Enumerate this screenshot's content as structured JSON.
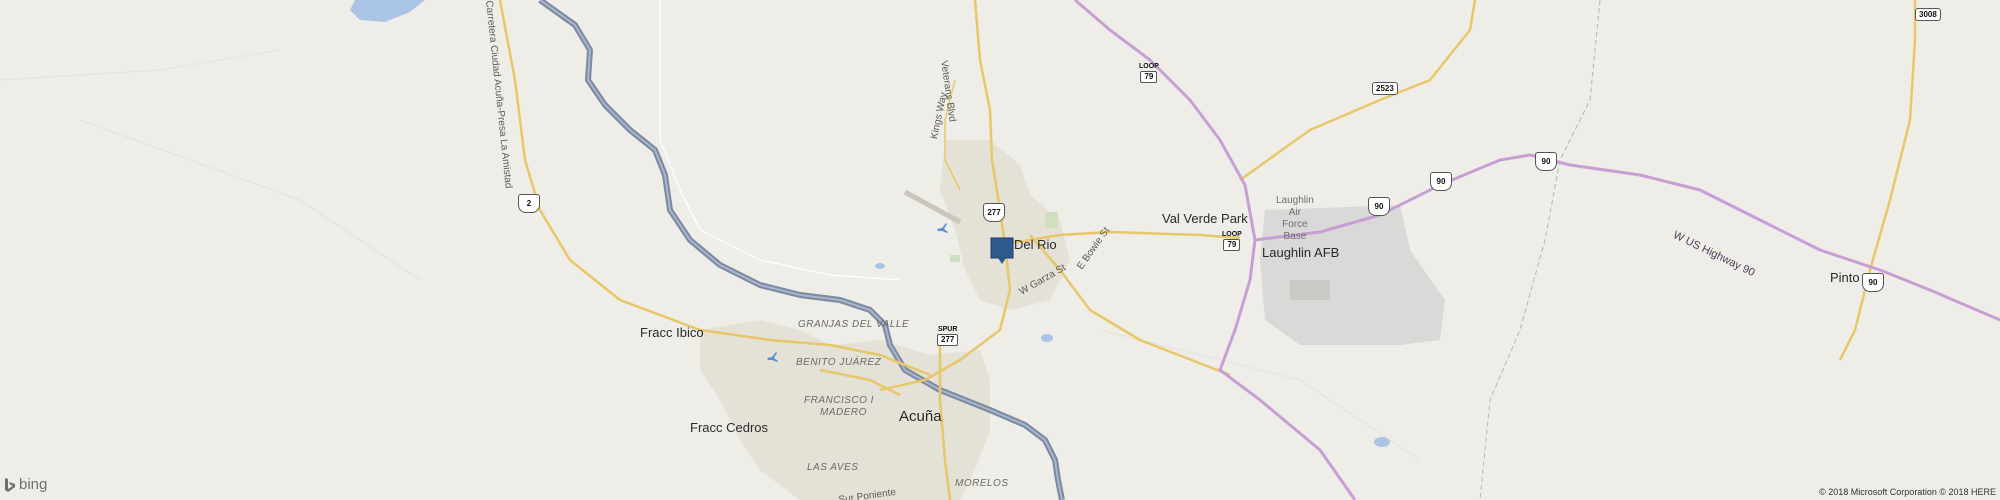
{
  "map": {
    "places": {
      "del_rio": "Del Rio",
      "val_verde_park": "Val Verde Park",
      "laughlin_afb": "Laughlin AFB",
      "pinto": "Pinto",
      "fracc_ibico": "Fracc Ibico",
      "fracc_cedros": "Fracc Cedros",
      "acuna": "Acuña"
    },
    "districts": {
      "granjas_del_valle": "GRANJAS DEL VALLE",
      "benito_juarez": "BENITO JUÁREZ",
      "francisco_madero_1": "FRANCISCO I",
      "francisco_madero_2": "MADERO",
      "las_aves": "LAS AVES",
      "morelos": "MORELOS"
    },
    "base_label": [
      "Laughlin",
      "Air",
      "Force",
      "Base"
    ],
    "streets": {
      "veterans_blvd": "Veterans Blvd",
      "kings_way": "Kings Way",
      "w_garza_st": "W Garza St",
      "e_bowie_st": "E Bowie St",
      "carretera": "Carretera Ciudad Acuña-Presa La Amistad",
      "sur_poniente": "Sur Poniente",
      "w_us_highway_90": "W US Highway 90"
    },
    "shields": {
      "us277_a": "277",
      "spur_label": "SPUR",
      "spur_num": "277",
      "loop_north_label": "LOOP",
      "loop_north_num": "79",
      "loop_south_label": "LOOP",
      "loop_south_num": "79",
      "fm2523": "2523",
      "fm3008": "3008",
      "us90_a": "90",
      "us90_b": "90",
      "us90_c": "90",
      "us90_d": "90",
      "mx2": "2"
    },
    "marker": "location-pin",
    "colors": {
      "land": "#efede8",
      "river": "#8a97ab",
      "water": "#a9c4e4",
      "highway": "#c29bd0",
      "major_road": "#f1d58c",
      "urban": "#e3e0d6",
      "base": "#d9d9d9",
      "marker": "#2d5a8e"
    }
  },
  "logo": {
    "text": "bing"
  },
  "copyright": "© 2018 Microsoft Corporation © 2018 HERE"
}
